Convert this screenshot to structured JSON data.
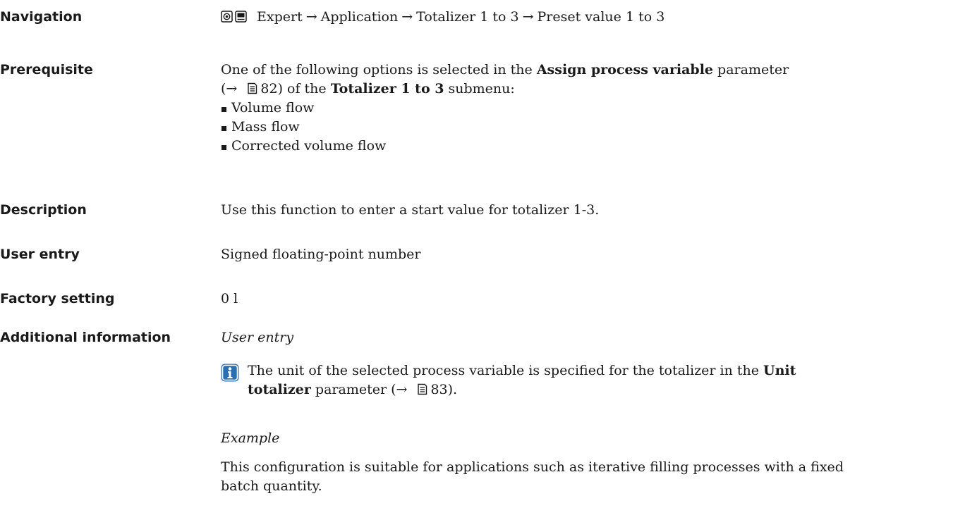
{
  "navigation": {
    "label": "Navigation",
    "path": [
      "Expert",
      "Application",
      "Totalizer 1 to 3",
      "Preset value 1 to 3"
    ],
    "separator": "→",
    "icons": [
      "display-operation-icon",
      "display-menu-icon"
    ]
  },
  "prerequisite": {
    "label": "Prerequisite",
    "line1_pre": "One of the following options is selected in the ",
    "line1_bold": "Assign process variable",
    "line1_post": " parameter",
    "line2_ref_open": "(→ ",
    "line2_ref_page": "82",
    "line2_mid": ") of the ",
    "line2_bold": "Totalizer 1 to 3",
    "line2_post": " submenu:",
    "options": [
      "Volume flow",
      "Mass flow",
      "Corrected volume flow"
    ]
  },
  "description": {
    "label": "Description",
    "text": "Use this function to enter a start value for totalizer 1-3."
  },
  "user_entry": {
    "label": "User entry",
    "text": "Signed floating-point number"
  },
  "factory_setting": {
    "label": "Factory setting",
    "text": "0 l"
  },
  "additional_information": {
    "label": "Additional information",
    "subheading1": "User entry",
    "note_pre": "The unit of the selected process variable is specified for the totalizer in the ",
    "note_bold1": "Unit",
    "note_bold2": "totalizer",
    "note_post_open": " parameter (→ ",
    "note_page": "83",
    "note_post_close": ").",
    "subheading2": "Example",
    "example_line1": "This configuration is suitable for applications such as iterative filling processes with a fixed",
    "example_line2": "batch quantity."
  },
  "colors": {
    "text": "#1a1a1a",
    "info_icon": "#2b6fb3"
  }
}
